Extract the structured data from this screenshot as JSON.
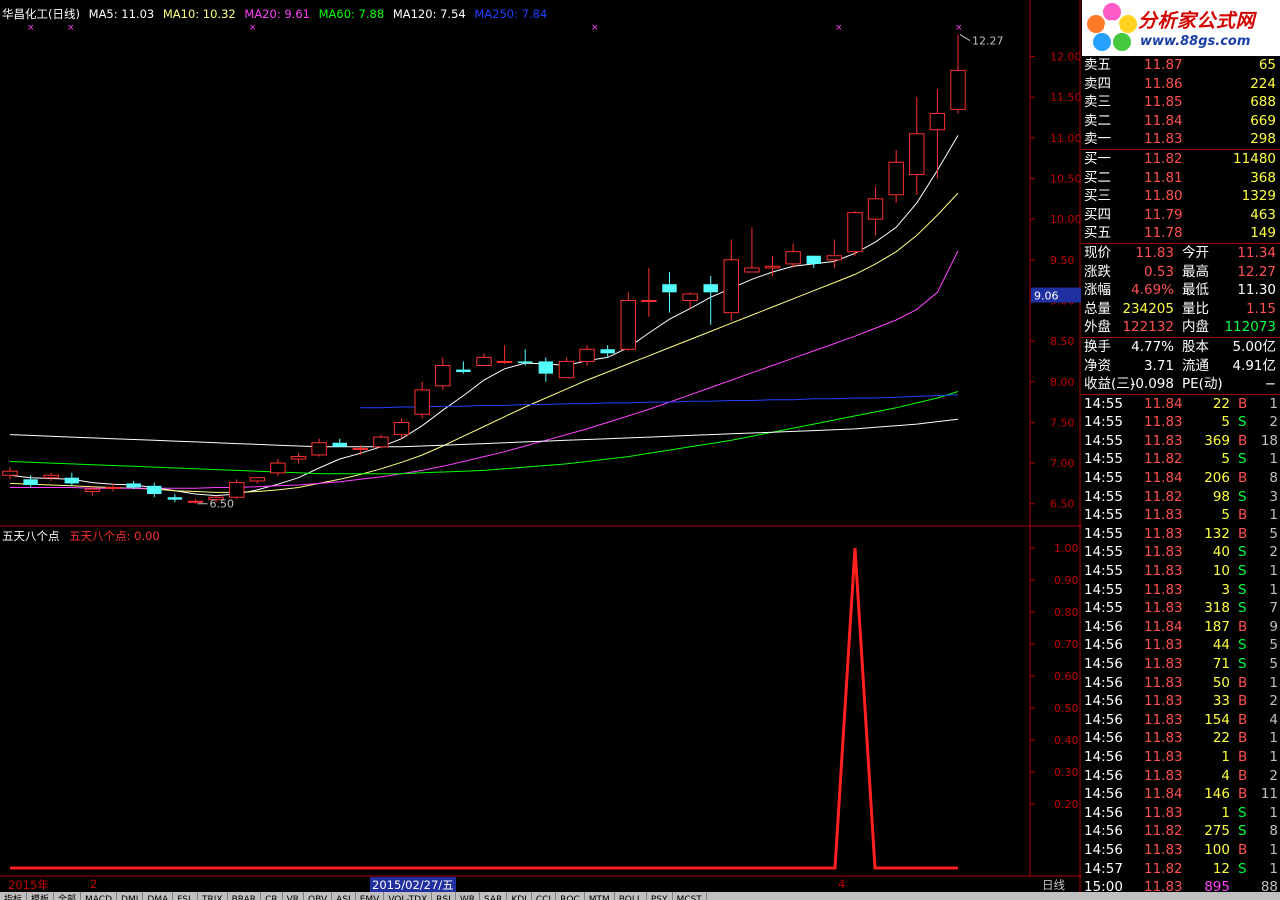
{
  "header": {
    "title": "华昌化工(日线)",
    "ma": [
      {
        "label": "MA5: 11.03",
        "color": "#ffffff"
      },
      {
        "label": "MA10: 10.32",
        "color": "#ffff80"
      },
      {
        "label": "MA20: 9.61",
        "color": "#ff40ff"
      },
      {
        "label": "MA60: 7.88",
        "color": "#00ff00"
      },
      {
        "label": "MA120: 7.54",
        "color": "#ffffff"
      },
      {
        "label": "MA250: 7.84",
        "color": "#2040ff"
      }
    ]
  },
  "indicator": {
    "name": "五天八个点",
    "value_label": "五天八个点: 0.00"
  },
  "price_axis": [
    "12.00",
    "11.50",
    "11.00",
    "10.50",
    "10.00",
    "9.50",
    "9.00",
    "8.50",
    "8.00",
    "7.50",
    "7.00",
    "6.50"
  ],
  "current_price_tag": "9.06",
  "ind_axis": [
    "1.00",
    "0.90",
    "0.80",
    "0.70",
    "0.60",
    "0.50",
    "0.40",
    "0.30",
    "0.20"
  ],
  "chart_annotations": {
    "high": "12.27",
    "low": "6.50"
  },
  "dates": {
    "year": "2015年",
    "m2": "2",
    "cursor": "2015/02/27/五",
    "m4": "4",
    "period": "日线"
  },
  "chart_data": {
    "type": "candlestick",
    "ylim": [
      6.3,
      12.4
    ],
    "candles": [
      [
        6.85,
        6.95,
        6.8,
        6.9
      ],
      [
        6.8,
        6.85,
        6.7,
        6.73
      ],
      [
        6.82,
        6.88,
        6.78,
        6.85
      ],
      [
        6.82,
        6.88,
        6.72,
        6.75
      ],
      [
        6.65,
        6.72,
        6.6,
        6.68
      ],
      [
        6.7,
        6.75,
        6.65,
        6.7
      ],
      [
        6.75,
        6.78,
        6.68,
        6.7
      ],
      [
        6.72,
        6.76,
        6.58,
        6.62
      ],
      [
        6.58,
        6.62,
        6.52,
        6.55
      ],
      [
        6.52,
        6.56,
        6.5,
        6.53
      ],
      [
        6.55,
        6.6,
        6.52,
        6.58
      ],
      [
        6.58,
        6.8,
        6.56,
        6.76
      ],
      [
        6.78,
        6.82,
        6.75,
        6.82
      ],
      [
        6.88,
        7.05,
        6.84,
        7.0
      ],
      [
        7.05,
        7.12,
        7.0,
        7.08
      ],
      [
        7.1,
        7.3,
        7.08,
        7.25
      ],
      [
        7.25,
        7.3,
        7.2,
        7.2
      ],
      [
        7.18,
        7.22,
        7.1,
        7.18
      ],
      [
        7.2,
        7.35,
        7.18,
        7.32
      ],
      [
        7.35,
        7.55,
        7.3,
        7.5
      ],
      [
        7.6,
        8.0,
        7.55,
        7.9
      ],
      [
        7.95,
        8.3,
        7.9,
        8.2
      ],
      [
        8.15,
        8.25,
        8.1,
        8.12
      ],
      [
        8.2,
        8.35,
        8.2,
        8.3
      ],
      [
        8.25,
        8.45,
        8.22,
        8.25
      ],
      [
        8.25,
        8.4,
        8.2,
        8.23
      ],
      [
        8.25,
        8.3,
        8.0,
        8.1
      ],
      [
        8.05,
        8.3,
        8.05,
        8.25
      ],
      [
        8.25,
        8.45,
        8.2,
        8.4
      ],
      [
        8.4,
        8.45,
        8.3,
        8.35
      ],
      [
        8.4,
        9.1,
        8.38,
        9.0
      ],
      [
        9.0,
        9.4,
        8.8,
        9.0
      ],
      [
        9.2,
        9.35,
        8.85,
        9.1
      ],
      [
        9.0,
        9.1,
        8.9,
        9.08
      ],
      [
        9.2,
        9.3,
        8.7,
        9.1
      ],
      [
        8.85,
        9.75,
        8.75,
        9.5
      ],
      [
        9.35,
        9.9,
        9.35,
        9.4
      ],
      [
        9.4,
        9.55,
        9.3,
        9.42
      ],
      [
        9.45,
        9.7,
        9.4,
        9.6
      ],
      [
        9.55,
        9.55,
        9.4,
        9.45
      ],
      [
        9.5,
        9.75,
        9.4,
        9.55
      ],
      [
        9.6,
        10.1,
        9.55,
        10.08
      ],
      [
        10.0,
        10.4,
        9.8,
        10.25
      ],
      [
        10.3,
        10.85,
        10.2,
        10.7
      ],
      [
        10.55,
        11.5,
        10.3,
        11.05
      ],
      [
        11.1,
        11.6,
        10.5,
        11.3
      ],
      [
        11.35,
        12.27,
        11.3,
        11.83
      ]
    ],
    "moving_averages": {
      "MA5": [
        6.85,
        6.82,
        6.81,
        6.8,
        6.76,
        6.74,
        6.73,
        6.7,
        6.66,
        6.62,
        6.6,
        6.62,
        6.67,
        6.74,
        6.82,
        6.94,
        7.05,
        7.12,
        7.2,
        7.3,
        7.46,
        7.65,
        7.83,
        8.02,
        8.16,
        8.23,
        8.22,
        8.2,
        8.26,
        8.3,
        8.42,
        8.6,
        8.77,
        8.9,
        9.04,
        9.15,
        9.26,
        9.35,
        9.42,
        9.45,
        9.48,
        9.58,
        9.72,
        9.9,
        10.2,
        10.6,
        11.03
      ],
      "MA10": [
        6.75,
        6.74,
        6.73,
        6.72,
        6.71,
        6.7,
        6.69,
        6.68,
        6.66,
        6.65,
        6.64,
        6.64,
        6.65,
        6.67,
        6.7,
        6.75,
        6.8,
        6.86,
        6.93,
        7.01,
        7.1,
        7.21,
        7.33,
        7.45,
        7.57,
        7.69,
        7.8,
        7.91,
        8.02,
        8.12,
        8.22,
        8.32,
        8.42,
        8.52,
        8.62,
        8.72,
        8.82,
        8.92,
        9.02,
        9.12,
        9.22,
        9.32,
        9.45,
        9.6,
        9.8,
        10.05,
        10.32
      ],
      "MA20": [
        6.7,
        6.7,
        6.7,
        6.7,
        6.69,
        6.69,
        6.69,
        6.69,
        6.69,
        6.69,
        6.7,
        6.7,
        6.71,
        6.72,
        6.73,
        6.75,
        6.77,
        6.8,
        6.83,
        6.87,
        6.91,
        6.96,
        7.02,
        7.08,
        7.14,
        7.21,
        7.28,
        7.35,
        7.42,
        7.5,
        7.58,
        7.66,
        7.75,
        7.84,
        7.93,
        8.02,
        8.11,
        8.2,
        8.29,
        8.38,
        8.47,
        8.56,
        8.66,
        8.76,
        8.89,
        9.1,
        9.61
      ],
      "MA60": [
        7.02,
        7.01,
        7.0,
        6.99,
        6.98,
        6.97,
        6.96,
        6.95,
        6.94,
        6.93,
        6.92,
        6.91,
        6.9,
        6.89,
        6.88,
        6.87,
        6.87,
        6.87,
        6.87,
        6.87,
        6.88,
        6.89,
        6.9,
        6.91,
        6.93,
        6.95,
        6.97,
        6.99,
        7.02,
        7.05,
        7.08,
        7.12,
        7.16,
        7.2,
        7.24,
        7.28,
        7.33,
        7.38,
        7.43,
        7.48,
        7.53,
        7.58,
        7.63,
        7.68,
        7.74,
        7.8,
        7.88
      ],
      "MA120": [
        7.35,
        7.34,
        7.33,
        7.32,
        7.31,
        7.3,
        7.29,
        7.28,
        7.27,
        7.26,
        7.25,
        7.24,
        7.23,
        7.22,
        7.21,
        7.2,
        7.2,
        7.2,
        7.2,
        7.2,
        7.21,
        7.22,
        7.23,
        7.24,
        7.25,
        7.26,
        7.27,
        7.28,
        7.29,
        7.3,
        7.31,
        7.32,
        7.33,
        7.34,
        7.35,
        7.36,
        7.37,
        7.38,
        7.39,
        7.4,
        7.41,
        7.42,
        7.44,
        7.46,
        7.48,
        7.51,
        7.54
      ],
      "MA250": [
        null,
        null,
        null,
        null,
        null,
        null,
        null,
        null,
        null,
        null,
        null,
        null,
        null,
        null,
        null,
        null,
        null,
        7.68,
        7.68,
        7.69,
        7.69,
        7.7,
        7.7,
        7.71,
        7.71,
        7.72,
        7.72,
        7.73,
        7.73,
        7.74,
        7.74,
        7.75,
        7.75,
        7.76,
        7.76,
        7.77,
        7.77,
        7.78,
        7.78,
        7.79,
        7.79,
        7.8,
        7.8,
        7.81,
        7.82,
        7.83,
        7.84
      ]
    },
    "indicator": {
      "name": "五天八个点",
      "ylim": [
        0,
        1.05
      ],
      "values": [
        0,
        0,
        0,
        0,
        0,
        0,
        0,
        0,
        0,
        0,
        0,
        0,
        0,
        0,
        0,
        0,
        0,
        0,
        0,
        0,
        0,
        0,
        0,
        0,
        0,
        0,
        0,
        0,
        0,
        0,
        0,
        0,
        0,
        0,
        0,
        0,
        0,
        0,
        0,
        0,
        0,
        1,
        0,
        0,
        0,
        0,
        0
      ]
    }
  },
  "quotes": {
    "asks": [
      {
        "label": "卖五",
        "price": "11.87",
        "vol": "65"
      },
      {
        "label": "卖四",
        "price": "11.86",
        "vol": "224"
      },
      {
        "label": "卖三",
        "price": "11.85",
        "vol": "688"
      },
      {
        "label": "卖二",
        "price": "11.84",
        "vol": "669"
      },
      {
        "label": "卖一",
        "price": "11.83",
        "vol": "298"
      }
    ],
    "bids": [
      {
        "label": "买一",
        "price": "11.82",
        "vol": "11480"
      },
      {
        "label": "买二",
        "price": "11.81",
        "vol": "368"
      },
      {
        "label": "买三",
        "price": "11.80",
        "vol": "1329"
      },
      {
        "label": "买四",
        "price": "11.79",
        "vol": "463"
      },
      {
        "label": "买五",
        "price": "11.78",
        "vol": "149"
      }
    ],
    "stats1": [
      {
        "l1": "现价",
        "v1": "11.83",
        "c1": "#ff5050",
        "l2": "今开",
        "v2": "11.34",
        "c2": "#ff5050"
      },
      {
        "l1": "涨跌",
        "v1": "0.53",
        "c1": "#ff5050",
        "l2": "最高",
        "v2": "12.27",
        "c2": "#ff5050"
      },
      {
        "l1": "涨幅",
        "v1": "4.69%",
        "c1": "#ff5050",
        "l2": "最低",
        "v2": "11.30",
        "c2": "#ffffff"
      },
      {
        "l1": "总量",
        "v1": "234205",
        "c1": "#ffff40",
        "l2": "量比",
        "v2": "1.15",
        "c2": "#ff5050"
      },
      {
        "l1": "外盘",
        "v1": "122132",
        "c1": "#ff5050",
        "l2": "内盘",
        "v2": "112073",
        "c2": "#00ff40"
      }
    ],
    "stats2": [
      {
        "l1": "换手",
        "v1": "4.77%",
        "c1": "#ffffff",
        "l2": "股本",
        "v2": "5.00亿",
        "c2": "#ffffff"
      },
      {
        "l1": "净资",
        "v1": "3.71",
        "c1": "#ffffff",
        "l2": "流通",
        "v2": "4.91亿",
        "c2": "#ffffff"
      },
      {
        "l1": "收益(三)",
        "v1": "-0.098",
        "c1": "#ffffff",
        "l2": "PE(动)",
        "v2": "−",
        "c2": "#ffffff"
      }
    ],
    "ticks": [
      [
        "14:55",
        "11.84",
        "22",
        "B",
        "1"
      ],
      [
        "14:55",
        "11.83",
        "5",
        "S",
        "2"
      ],
      [
        "14:55",
        "11.83",
        "369",
        "B",
        "18"
      ],
      [
        "14:55",
        "11.82",
        "5",
        "S",
        "1"
      ],
      [
        "14:55",
        "11.84",
        "206",
        "B",
        "8"
      ],
      [
        "14:55",
        "11.82",
        "98",
        "S",
        "3"
      ],
      [
        "14:55",
        "11.83",
        "5",
        "B",
        "1"
      ],
      [
        "14:55",
        "11.83",
        "132",
        "B",
        "5"
      ],
      [
        "14:55",
        "11.83",
        "40",
        "S",
        "2"
      ],
      [
        "14:55",
        "11.83",
        "10",
        "S",
        "1"
      ],
      [
        "14:55",
        "11.83",
        "3",
        "S",
        "1"
      ],
      [
        "14:55",
        "11.83",
        "318",
        "S",
        "7"
      ],
      [
        "14:56",
        "11.84",
        "187",
        "B",
        "9"
      ],
      [
        "14:56",
        "11.83",
        "44",
        "S",
        "5"
      ],
      [
        "14:56",
        "11.83",
        "71",
        "S",
        "5"
      ],
      [
        "14:56",
        "11.83",
        "50",
        "B",
        "1"
      ],
      [
        "14:56",
        "11.83",
        "33",
        "B",
        "2"
      ],
      [
        "14:56",
        "11.83",
        "154",
        "B",
        "4"
      ],
      [
        "14:56",
        "11.83",
        "22",
        "B",
        "1"
      ],
      [
        "14:56",
        "11.83",
        "1",
        "B",
        "1"
      ],
      [
        "14:56",
        "11.83",
        "4",
        "B",
        "2"
      ],
      [
        "14:56",
        "11.84",
        "146",
        "B",
        "11"
      ],
      [
        "14:56",
        "11.83",
        "1",
        "S",
        "1"
      ],
      [
        "14:56",
        "11.82",
        "275",
        "S",
        "8"
      ],
      [
        "14:56",
        "11.83",
        "100",
        "B",
        "1"
      ],
      [
        "14:57",
        "11.82",
        "12",
        "S",
        "1"
      ],
      [
        "15:00",
        "11.83",
        "895",
        "",
        "88"
      ]
    ]
  },
  "logo": {
    "name": "分析家公式网",
    "url_text": "www.88gs.com"
  },
  "tabs": [
    "指标",
    "模板",
    "全部",
    "MACD",
    "DMI",
    "DMA",
    "FSL",
    "TRIX",
    "BRAR",
    "CR",
    "VR",
    "OBV",
    "ASI",
    "EMV",
    "VOL-TDX",
    "RSI",
    "WR",
    "SAR",
    "KDJ",
    "CCI",
    "ROC",
    "MTM",
    "BOLL",
    "PSY",
    "MCST"
  ],
  "colors": {
    "up": "#ff3030",
    "down": "#54ffff",
    "grid": "#b00000"
  }
}
